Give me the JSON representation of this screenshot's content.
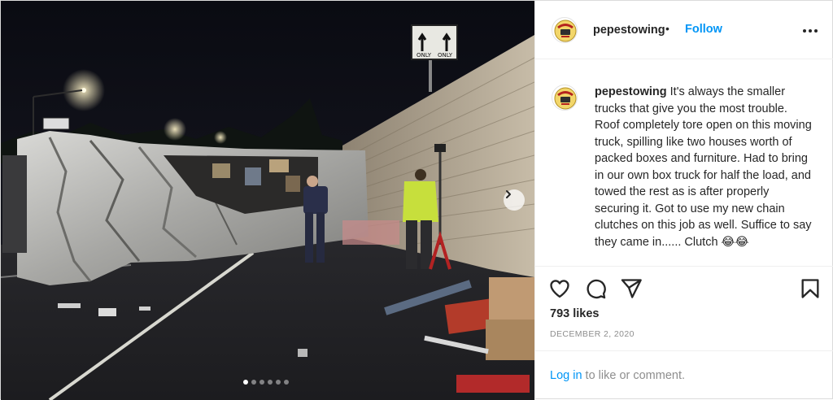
{
  "post": {
    "username": "pepestowing",
    "separator": "•",
    "follow_label": "Follow",
    "caption_username": "pepestowing",
    "caption_text": "It's always the smaller trucks that give you the most trouble. Roof completely tore open on this moving truck, spilling like two houses worth of packed boxes and furniture. Had to bring in our own box truck for half the load, and towed the rest as is after properly securing it. Got to use my new chain clutches on this job as well. Suffice to say they came in...... Clutch 😂😂",
    "likes": "793 likes",
    "date": "DECEMBER 2, 2020",
    "login_link": "Log in",
    "login_suffix": " to like or comment."
  },
  "media": {
    "sign_text_left": "ONLY",
    "sign_text_right": "ONLY",
    "carousel_count": 6,
    "carousel_active": 1
  },
  "icons": {
    "like": "heart-icon",
    "comment": "comment-icon",
    "share": "paper-plane-icon",
    "save": "bookmark-icon",
    "more": "more-options-icon",
    "next": "chevron-right-icon"
  },
  "colors": {
    "link_blue": "#0095f6",
    "text": "#262626",
    "muted": "#8e8e8e",
    "border": "#efefef"
  }
}
